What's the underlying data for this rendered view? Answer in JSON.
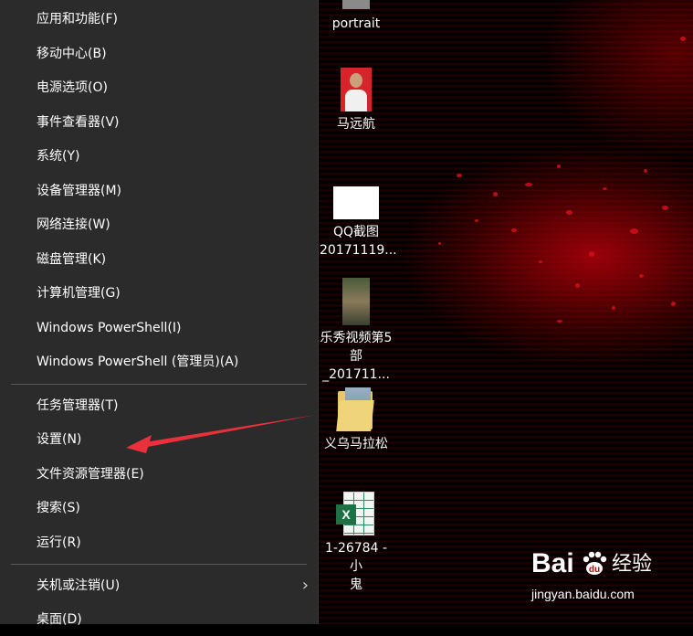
{
  "start_menu": {
    "items": [
      {
        "label": "应用和功能(F)"
      },
      {
        "label": "移动中心(B)"
      },
      {
        "label": "电源选项(O)"
      },
      {
        "label": "事件查看器(V)"
      },
      {
        "label": "系统(Y)"
      },
      {
        "label": "设备管理器(M)"
      },
      {
        "label": "网络连接(W)"
      },
      {
        "label": "磁盘管理(K)"
      },
      {
        "label": "计算机管理(G)"
      },
      {
        "label": "Windows PowerShell(I)"
      },
      {
        "label": "Windows PowerShell (管理员)(A)"
      },
      {
        "label": "任务管理器(T)"
      },
      {
        "label": "设置(N)"
      },
      {
        "label": "文件资源管理器(E)"
      },
      {
        "label": "搜索(S)"
      },
      {
        "label": "运行(R)"
      },
      {
        "label": "关机或注销(U)"
      },
      {
        "label": "桌面(D)"
      }
    ]
  },
  "desktop": {
    "icons": [
      {
        "label": "portrait",
        "icon": "image-file-icon"
      },
      {
        "label": "马远航",
        "icon": "portrait-photo-icon"
      },
      {
        "label": "QQ截图 20171119...",
        "label_line1": "QQ截图",
        "label_line2": "20171119...",
        "icon": "blank-image-icon"
      },
      {
        "label_line1": "乐秀视频第5",
        "label_line2": "部_201711...",
        "icon": "video-thumbnail-icon"
      },
      {
        "label": "义乌马拉松",
        "icon": "folder-icon"
      },
      {
        "label_line1": "1-26784 -小",
        "label_line2": "鬼",
        "icon": "excel-file-icon"
      }
    ]
  },
  "watermark": {
    "brand": "Bai",
    "brand_suffix": "经验",
    "url": "jingyan.baidu.com"
  },
  "colors": {
    "menu_bg": "#2b2b2b",
    "annotation_arrow": "#e8313a",
    "desktop_accent": "#d0101a"
  }
}
